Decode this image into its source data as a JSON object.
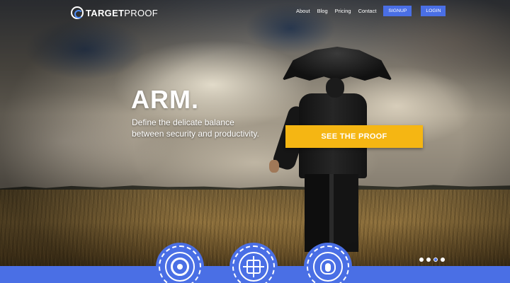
{
  "brand": {
    "logo_strong": "TARGET",
    "logo_light": "PROOF",
    "accent": "#4a6fe5",
    "cta_color": "#f5b613"
  },
  "nav": {
    "links": [
      "About",
      "Blog",
      "Pricing",
      "Contact"
    ],
    "signup": "SIGNUP",
    "login": "LOGIN"
  },
  "hero": {
    "title": "ARM.",
    "subtitle": "Define the delicate balance between security and productivity.",
    "cta": "SEE THE PROOF"
  },
  "slider": {
    "count": 4,
    "active_index": 2
  },
  "features": [
    {
      "icon": "target-icon"
    },
    {
      "icon": "crosshair-icon"
    },
    {
      "icon": "touch-icon"
    }
  ]
}
